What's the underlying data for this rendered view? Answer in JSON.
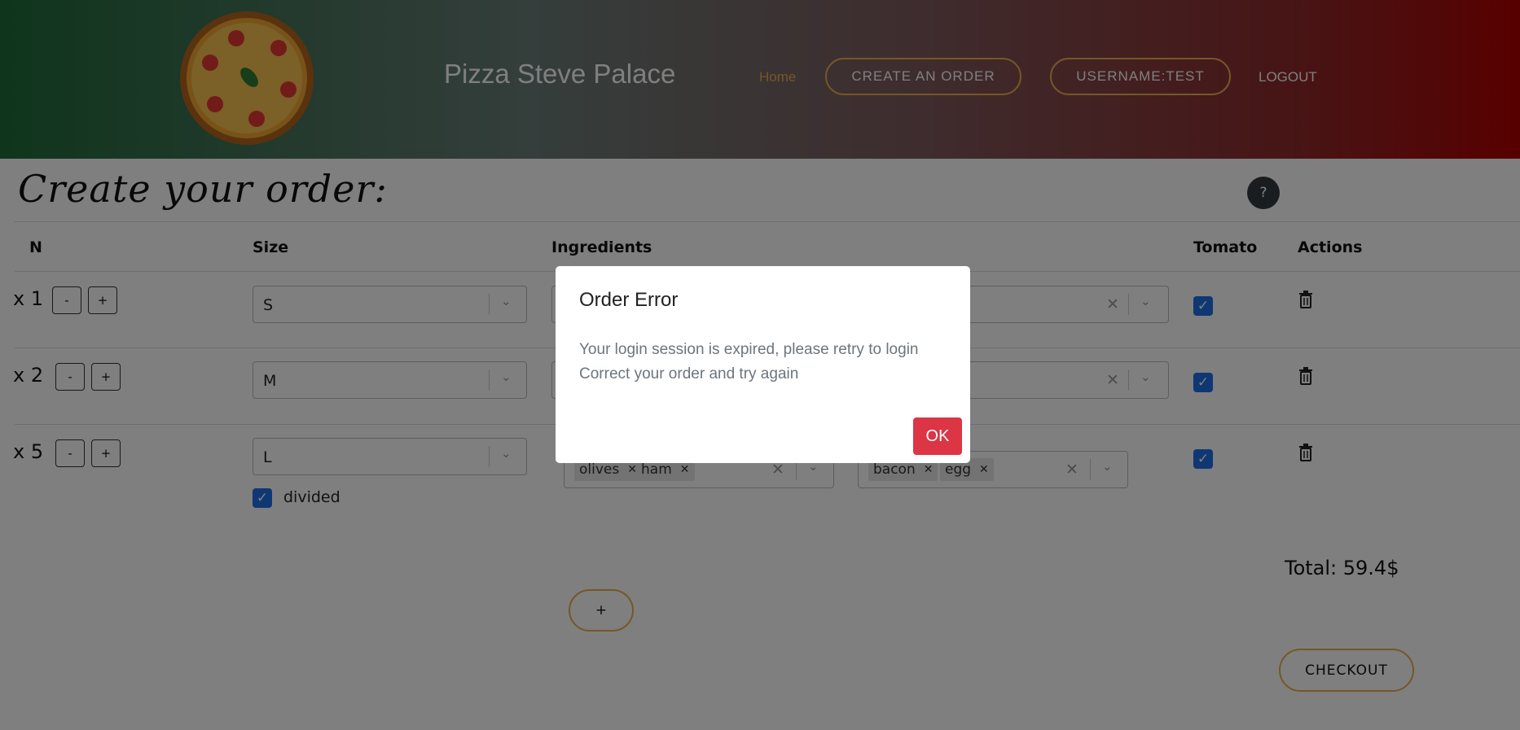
{
  "header": {
    "brand": "Pizza Steve Palace",
    "nav": {
      "home": "Home",
      "create_order": "CREATE AN ORDER",
      "username": "USERNAME:TEST",
      "logout": "LOGOUT"
    }
  },
  "page": {
    "title": "Create your order:",
    "help_label": "?"
  },
  "table": {
    "headers": {
      "n": "N",
      "size": "Size",
      "ingredients": "Ingredients",
      "tomato": "Tomato",
      "actions": "Actions"
    },
    "rows": [
      {
        "qty": "x 1",
        "minus": "-",
        "plus": "+",
        "size": "S",
        "tomato": true
      },
      {
        "qty": "x 2",
        "minus": "-",
        "plus": "+",
        "size": "M",
        "tomato": true
      },
      {
        "qty": "x 5",
        "minus": "-",
        "plus": "+",
        "size": "L",
        "tomato": true,
        "divided_label": "divided",
        "divided": true,
        "half1_tags": [
          "olives",
          "ham"
        ],
        "half2_tags": [
          "bacon",
          "egg"
        ]
      }
    ]
  },
  "footer": {
    "total": "Total: 59.4$",
    "add_label": "+",
    "checkout_label": "CHECKOUT"
  },
  "modal": {
    "title": "Order Error",
    "line1": "Your login session is expired, please retry to login",
    "line2": "Correct your order and try again",
    "ok_label": "OK"
  },
  "icons": {
    "chevron": "chevron-down-icon",
    "clear": "close-icon",
    "check": "check-icon",
    "trash": "trash-icon"
  },
  "colors": {
    "accent": "#e8b04a",
    "danger": "#dc3545",
    "checkbox": "#1d6fe6",
    "help": "#343a40"
  }
}
